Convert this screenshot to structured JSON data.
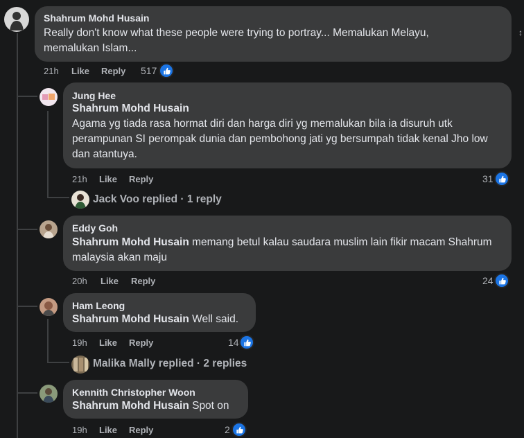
{
  "comments": [
    {
      "name": "Shahrum Mohd Husain",
      "text": "Really don't know what these people were trying to portray... Memalukan Melayu, memalukan Islam...",
      "time": "21h",
      "like": "Like",
      "reply": "Reply",
      "reactions": "517"
    },
    {
      "name": "Jung Hee",
      "mention": "Shahrum Mohd Husain",
      "text": "Agama yg tiada rasa hormat diri dan harga diri yg memalukan bila ia disuruh utk perampunan SI perompak dunia dan pembohong jati yg bersumpah tidak kenal Jho low dan atantuya.",
      "time": "21h",
      "like": "Like",
      "reply": "Reply",
      "reactions": "31",
      "replied": "Jack Voo replied · 1 reply"
    },
    {
      "name": "Eddy Goh",
      "mention": "Shahrum Mohd Husain",
      "text": " memang betul kalau saudara muslim lain fikir macam Shahrum malaysia akan maju",
      "time": "20h",
      "like": "Like",
      "reply": "Reply",
      "reactions": "24"
    },
    {
      "name": "Ham Leong",
      "mention": "Shahrum Mohd Husain",
      "text": " Well said.",
      "time": "19h",
      "like": "Like",
      "reply": "Reply",
      "reactions": "14",
      "replied": "Malika Mally replied · 2 replies"
    },
    {
      "name": "Kennith Christopher Woon",
      "mention": "Shahrum Mohd Husain",
      "text": " Spot on",
      "time": "19h",
      "like": "Like",
      "reply": "Reply",
      "reactions": "2"
    }
  ],
  "icons": {
    "like": "thumbs-up-icon"
  },
  "colors": {
    "background": "#18191a",
    "bubble": "#3a3b3c",
    "like_blue": "#1b74e4",
    "meta": "#b0b3b8"
  }
}
